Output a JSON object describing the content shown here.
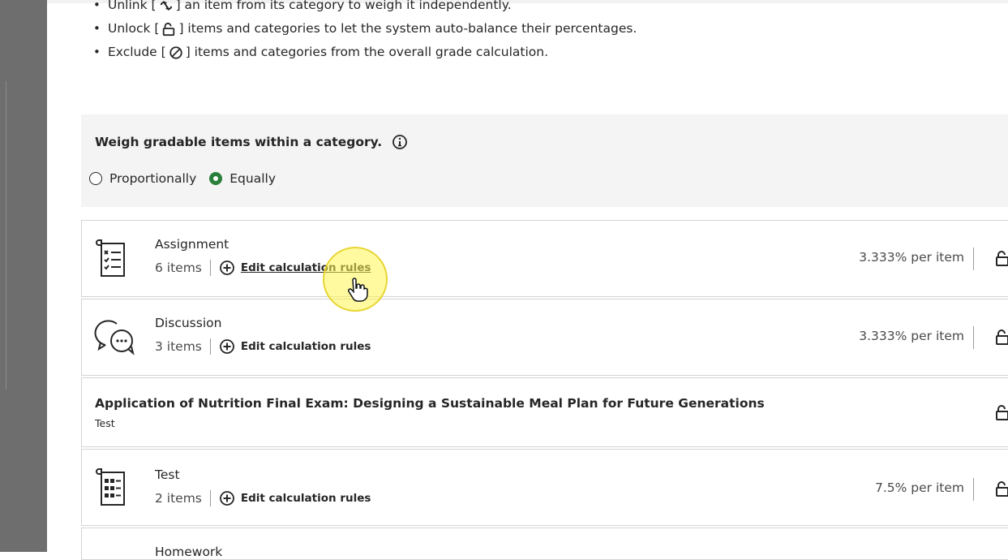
{
  "tips": [
    {
      "prefix": "Unlink [",
      "icon": "unlink-icon",
      "suffix": "] an item from its category to weigh it independently."
    },
    {
      "prefix": "Unlock [",
      "icon": "unlock-icon",
      "suffix": "] items and categories to let the system auto-balance their percentages."
    },
    {
      "prefix": "Exclude [",
      "icon": "exclude-icon",
      "suffix": "] items and categories from the overall grade calculation."
    }
  ],
  "weigh": {
    "title": "Weigh gradable items within a category.",
    "options": [
      {
        "label": "Proportionally",
        "selected": false
      },
      {
        "label": "Equally",
        "selected": true
      }
    ]
  },
  "categories": [
    {
      "name": "Assignment",
      "count": "6 items",
      "edit_label": "Edit calculation rules",
      "percent": "3.333% per item",
      "icon": "assignment-icon"
    },
    {
      "name": "Discussion",
      "count": "3 items",
      "edit_label": "Edit calculation rules",
      "percent": "3.333% per item",
      "icon": "discussion-icon"
    },
    {
      "name": "Test",
      "count": "2 items",
      "edit_label": "Edit calculation rules",
      "percent": "7.5% per item",
      "icon": "test-icon"
    }
  ],
  "exam": {
    "title": "Application of Nutrition Final Exam: Designing a Sustainable Meal Plan for Future Generations",
    "type": "Test"
  },
  "partial_card": {
    "name": "Homework"
  },
  "colors": {
    "accent_green": "#2a7f3b",
    "rail": "#6e6e6e",
    "panel": "#f4f4f4",
    "highlight": "#fff550"
  }
}
